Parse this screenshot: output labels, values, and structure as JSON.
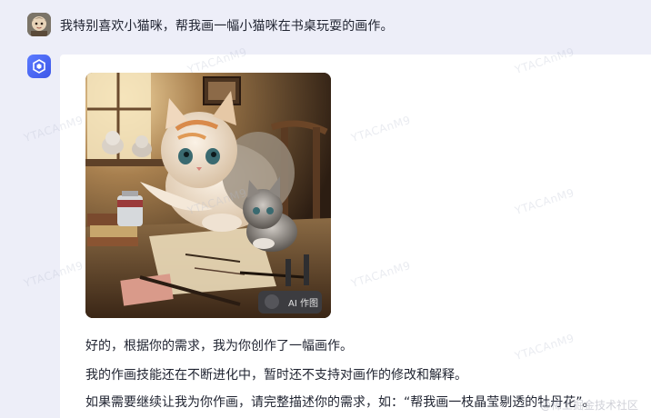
{
  "conversation": {
    "user_message": "我特别喜欢小猫咪，帮我画一幅小猫咪在书桌玩耍的画作。",
    "bot": {
      "image_badge": "AI 作图",
      "reply_lines": [
        "好的，根据你的需求，我为你创作了一幅画作。",
        "我的作画技能还在不断进化中，暂时还不支持对画作的修改和解释。",
        "如果需要继续让我为你作画，请完整描述你的需求，如：“帮我画一枝晶莹剔透的牡丹花”。"
      ]
    }
  },
  "watermark_text": "YTACAnM9",
  "corner_credit": "@稀土掘金技术社区",
  "colors": {
    "page_bg": "#edeef8",
    "card_bg": "#ffffff",
    "bot_avatar": "#4a66f2",
    "text": "#1f2330"
  },
  "icons": {
    "user_avatar": "avatar-icon",
    "bot_avatar": "bot-logo-icon"
  }
}
